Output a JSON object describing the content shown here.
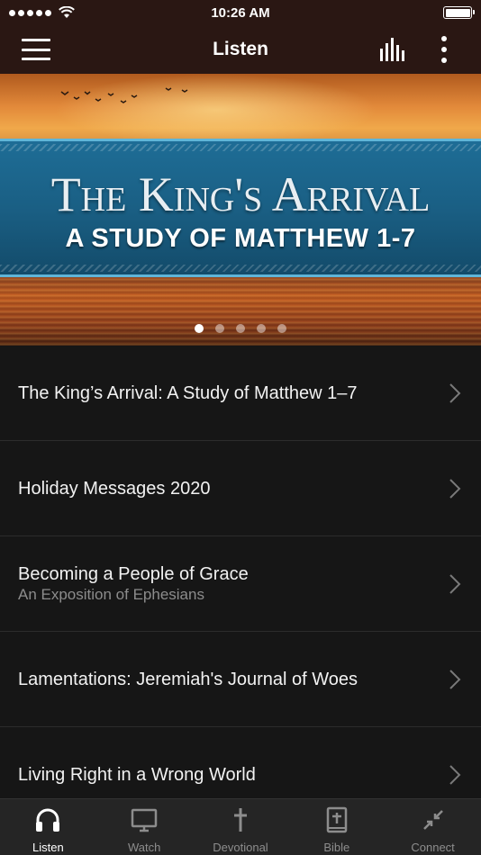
{
  "status_bar": {
    "time": "10:26 AM"
  },
  "header": {
    "title": "Listen"
  },
  "banner": {
    "title": "The King's Arrival",
    "subtitle": "A STUDY OF MATTHEW 1-7",
    "page_count": 5,
    "active_page": 1
  },
  "series": [
    {
      "title": "The King’s Arrival: A Study of Matthew 1–7",
      "subtitle": ""
    },
    {
      "title": "Holiday Messages 2020",
      "subtitle": ""
    },
    {
      "title": "Becoming a People of Grace",
      "subtitle": "An Exposition of Ephesians"
    },
    {
      "title": "Lamentations: Jeremiah's Journal of Woes",
      "subtitle": ""
    },
    {
      "title": "Living Right in a Wrong World",
      "subtitle": ""
    }
  ],
  "tabs": [
    {
      "label": "Listen",
      "icon": "headphones-icon",
      "active": true
    },
    {
      "label": "Watch",
      "icon": "tv-icon",
      "active": false
    },
    {
      "label": "Devotional",
      "icon": "cross-icon",
      "active": false
    },
    {
      "label": "Bible",
      "icon": "bible-icon",
      "active": false
    },
    {
      "label": "Connect",
      "icon": "connect-icon",
      "active": false
    }
  ],
  "colors": {
    "header_bg": "#2a1713",
    "list_bg": "#161616",
    "tab_bar_bg": "#252525",
    "tab_inactive": "#8d8d8d",
    "tab_active": "#ffffff",
    "subtitle_text": "#8c8c8c"
  }
}
